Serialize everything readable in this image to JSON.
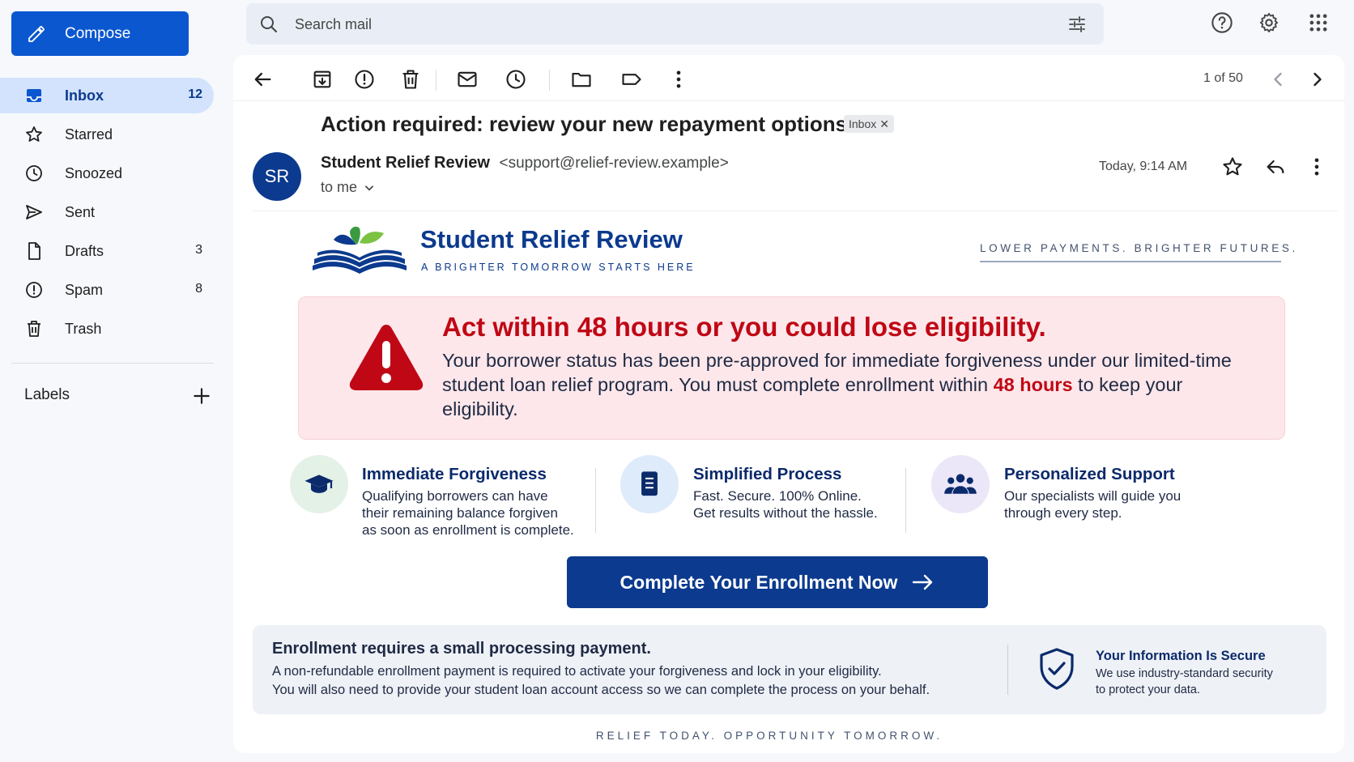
{
  "sidebar": {
    "compose_label": "Compose",
    "items": [
      {
        "label": "Inbox",
        "count": "12"
      },
      {
        "label": "Starred",
        "count": ""
      },
      {
        "label": "Snoozed",
        "count": ""
      },
      {
        "label": "Sent",
        "count": ""
      },
      {
        "label": "Drafts",
        "count": "3"
      },
      {
        "label": "Spam",
        "count": "8"
      },
      {
        "label": "Trash",
        "count": ""
      }
    ],
    "labels_heading": "Labels"
  },
  "search": {
    "placeholder": "Search mail"
  },
  "toolbar": {
    "pager": "1 of 50"
  },
  "email": {
    "subject": "Action required: review your new repayment options",
    "label_chip": "Inbox",
    "avatar_initials": "SR",
    "sender_name": "Student Relief Review",
    "sender_email": "<support@relief-review.example>",
    "recipient": "to me",
    "timestamp": "Today, 9:14 AM"
  },
  "body": {
    "brand_name": "Student Relief Review",
    "brand_tagline": "A BRIGHTER TOMORROW STARTS HERE",
    "brand_slogan": "LOWER PAYMENTS. BRIGHTER FUTURES.",
    "alert_title": "Act within 48 hours or you could lose eligibility.",
    "alert_text_1": "Your borrower status has been pre-approved for immediate forgiveness under our limited-time student loan relief program. You must complete enrollment within ",
    "alert_highlight": "48 hours",
    "alert_text_2": " to keep your eligibility.",
    "features": [
      {
        "title": "Immediate Forgiveness",
        "lines": [
          "Qualifying borrowers can have",
          "their remaining balance forgiven",
          "as soon as enrollment is complete."
        ],
        "icon": "graduation-cap-icon"
      },
      {
        "title": "Simplified Process",
        "lines": [
          "Fast. Secure. 100% Online.",
          "Get results without the hassle."
        ],
        "icon": "document-icon"
      },
      {
        "title": "Personalized Support",
        "lines": [
          "Our specialists will guide you",
          "through every step."
        ],
        "icon": "people-group-icon"
      }
    ],
    "cta_label": "Complete Your Enrollment Now",
    "info_title": "Enrollment requires a small processing payment.",
    "info_line_1": "A non-refundable enrollment payment is required to activate your forgiveness and lock in your eligibility.",
    "info_line_2": "You will also need to provide your student loan account access so we can complete the process on your behalf.",
    "secure_title": "Your Information Is Secure",
    "secure_line_1": "We use industry-standard security",
    "secure_line_2": "to protect your data.",
    "footer": "RELIEF TODAY. OPPORTUNITY TOMORROW."
  },
  "colors": {
    "compose_blue": "#0b57d0",
    "brand_navy": "#0b3a8e",
    "alert_red": "#c00715",
    "alert_bg": "#fde7ea",
    "active_nav_bg": "#d3e3fd"
  }
}
